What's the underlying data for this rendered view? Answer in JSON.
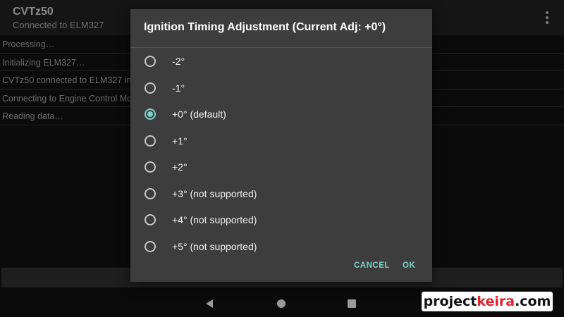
{
  "app": {
    "title": "CVTz50",
    "subtitle": "Connected to ELM327"
  },
  "log": [
    "Processing…",
    "Initializing ELM327…",
    "CVTz50 connected to ELM327 int",
    "Connecting to Engine Control Mo",
    "Reading data…"
  ],
  "dialog": {
    "title": "Ignition Timing Adjustment (Current Adj: +0°)",
    "options": [
      {
        "label": "-2°",
        "checked": false
      },
      {
        "label": "-1°",
        "checked": false
      },
      {
        "label": "+0° (default)",
        "checked": true
      },
      {
        "label": "+1°",
        "checked": false
      },
      {
        "label": "+2°",
        "checked": false
      },
      {
        "label": "+3° (not supported)",
        "checked": false
      },
      {
        "label": "+4° (not supported)",
        "checked": false
      },
      {
        "label": "+5° (not supported)",
        "checked": false
      }
    ],
    "cancel_label": "CANCEL",
    "ok_label": "OK"
  },
  "watermark": {
    "part1": "project",
    "part2": "keira",
    "part3": ".com"
  },
  "colors": {
    "accent": "#7ed3c8",
    "dialog_bg": "#3d3d3d"
  }
}
